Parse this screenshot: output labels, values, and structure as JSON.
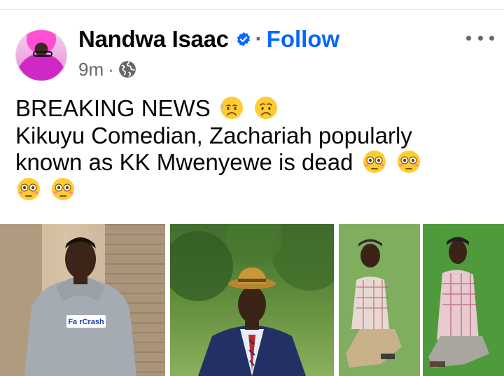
{
  "post": {
    "author": "Nandwa Isaac",
    "follow_label": "Follow",
    "separator": "·",
    "time": "9m",
    "audience_icon": "globe-icon",
    "verified_icon": "verified-badge-icon",
    "text_line_1": "BREAKING NEWS",
    "text_line_2": "Kikuyu Comedian, Zachariah popularly",
    "text_line_3": "known as KK Mwenyewe is dead",
    "hoodie_text": "Fa rCrash"
  },
  "colors": {
    "accent": "#0866ff",
    "secondary_text": "#65676b",
    "primary_text": "#050505"
  },
  "photos": [
    "photo-hoodie",
    "photo-hat-suit",
    "photo-two-men-grass"
  ]
}
